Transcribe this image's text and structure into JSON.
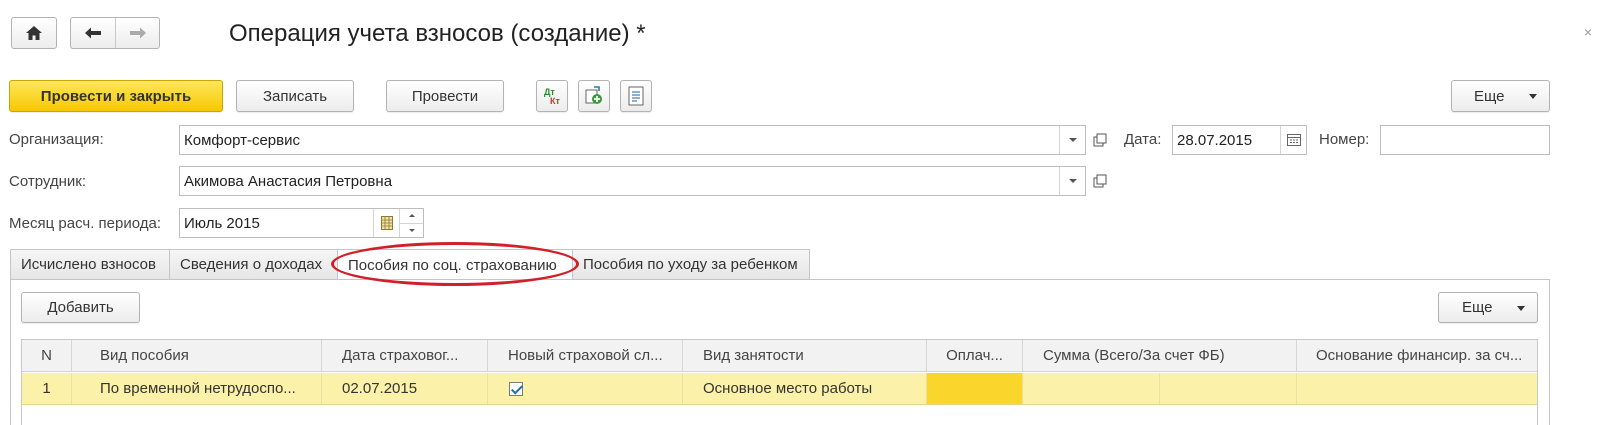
{
  "window": {
    "title": "Операция учета взносов (создание) *",
    "close_symbol": "×"
  },
  "toolbar": {
    "post_close_label": "Провести и закрыть",
    "save_label": "Записать",
    "post_label": "Провести",
    "dt_kt_label": "Дт\nКт",
    "more_label": "Еще"
  },
  "form": {
    "organization_label": "Организация:",
    "organization_value": "Комфорт-сервис",
    "date_label": "Дата:",
    "date_value": "28.07.2015",
    "number_label": "Номер:",
    "number_value": "",
    "employee_label": "Сотрудник:",
    "employee_value": "Акимова Анастасия Петровна",
    "period_label": "Месяц расч. периода:",
    "period_value": "Июль 2015"
  },
  "tabs": [
    {
      "label": "Исчислено взносов"
    },
    {
      "label": "Сведения о доходах"
    },
    {
      "label": "Пособия по соц. страхованию"
    },
    {
      "label": "Пособия по уходу за ребенком"
    }
  ],
  "panel": {
    "add_label": "Добавить",
    "more_label": "Еще"
  },
  "table": {
    "columns": [
      "N",
      "Вид пособия",
      "Дата страховог...",
      "Новый страховой сл...",
      "Вид занятости",
      "Оплач...",
      "Сумма (Всего/За счет ФБ)",
      "Основание финансир. за сч..."
    ],
    "rows": [
      {
        "n": "1",
        "kind": "По временной нетрудоспо...",
        "date": "02.07.2015",
        "new_case": true,
        "employment": "Основное место работы",
        "paid": "",
        "sum_total": "",
        "sum_fb": "",
        "basis": ""
      }
    ]
  },
  "colors": {
    "accent_yellow": "#f6c800",
    "row_highlight": "#fbf1a9",
    "paid_cell": "#fad52c",
    "annotation_red": "#d0202a"
  }
}
